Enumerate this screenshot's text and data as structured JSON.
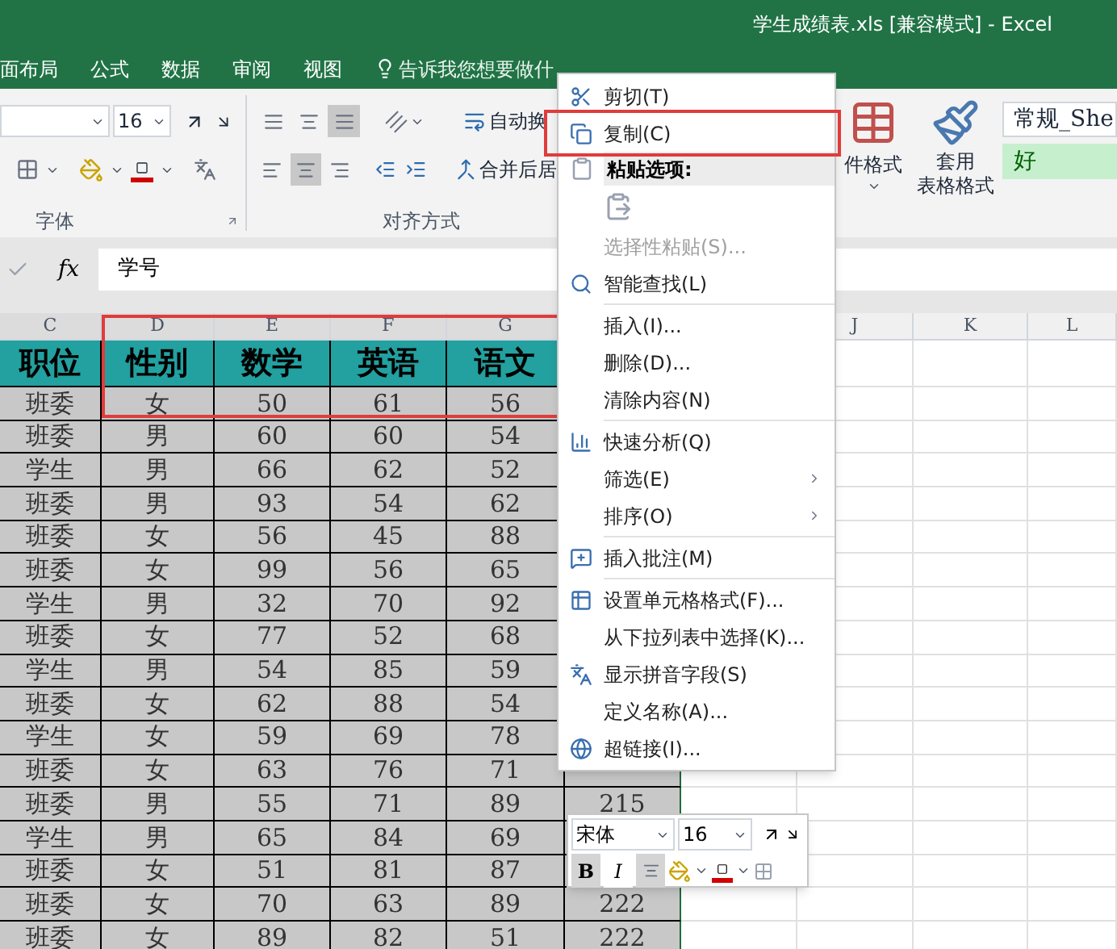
{
  "window": {
    "title": "学生成绩表.xls  [兼容模式] - Excel"
  },
  "tabs": [
    {
      "label": "面布局",
      "selected": false
    },
    {
      "label": "公式",
      "selected": false
    },
    {
      "label": "数据",
      "selected": false
    },
    {
      "label": "审阅",
      "selected": false
    },
    {
      "label": "视图",
      "selected": false
    }
  ],
  "tell_me": {
    "placeholder": "告诉我您想要做什"
  },
  "ribbon": {
    "font_size": "16",
    "font_group_label": "字体",
    "align_group_label": "对齐方式",
    "wrap_text": "自动换",
    "merge": "合并后居",
    "vertical_align": [
      {
        "pressed": false
      },
      {
        "pressed": false
      },
      {
        "pressed": true
      }
    ],
    "horizontal_align": [
      {
        "pressed": false
      },
      {
        "pressed": true
      },
      {
        "pressed": false
      }
    ],
    "conditional_format": "件格式",
    "table_format": [
      "套用",
      "表格格式"
    ],
    "styles": [
      {
        "label": "常规_She",
        "kind": "normal"
      },
      {
        "label": "好",
        "kind": "good"
      }
    ]
  },
  "formula_bar": {
    "function_label": "fx",
    "value": "学号"
  },
  "sheet": {
    "columns": [
      "C",
      "D",
      "E",
      "F",
      "G",
      null,
      null,
      "J",
      "K",
      "L"
    ],
    "header_row": [
      "职位",
      "性别",
      "数学",
      "英语",
      "语文"
    ],
    "rows": [
      {
        "cells": [
          "班委",
          "女",
          "50",
          "61",
          "56"
        ]
      },
      {
        "cells": [
          "班委",
          "男",
          "60",
          "60",
          "54"
        ]
      },
      {
        "cells": [
          "学生",
          "男",
          "66",
          "62",
          "52"
        ]
      },
      {
        "cells": [
          "班委",
          "男",
          "93",
          "54",
          "62"
        ]
      },
      {
        "cells": [
          "班委",
          "女",
          "56",
          "45",
          "88"
        ]
      },
      {
        "cells": [
          "班委",
          "女",
          "99",
          "56",
          "65"
        ]
      },
      {
        "cells": [
          "学生",
          "男",
          "32",
          "70",
          "92"
        ]
      },
      {
        "cells": [
          "班委",
          "女",
          "77",
          "52",
          "68"
        ]
      },
      {
        "cells": [
          "学生",
          "男",
          "54",
          "85",
          "59"
        ]
      },
      {
        "cells": [
          "班委",
          "女",
          "62",
          "88",
          "54"
        ]
      },
      {
        "cells": [
          "学生",
          "女",
          "59",
          "69",
          "78"
        ]
      },
      {
        "cells": [
          "班委",
          "女",
          "63",
          "76",
          "71"
        ]
      },
      {
        "cells": [
          "班委",
          "男",
          "55",
          "71",
          "89"
        ],
        "column_h": "215"
      },
      {
        "cells": [
          "学生",
          "男",
          "65",
          "84",
          "69"
        ]
      },
      {
        "cells": [
          "班委",
          "女",
          "51",
          "81",
          "87"
        ]
      },
      {
        "cells": [
          "班委",
          "女",
          "70",
          "63",
          "89"
        ],
        "column_h": "222"
      },
      {
        "cells": [
          "班委",
          "女",
          "89",
          "82",
          "51"
        ],
        "column_h": "222"
      }
    ]
  },
  "context_menu": [
    {
      "kind": "item",
      "label": "剪切(T)",
      "disabled": false,
      "submenu": false
    },
    {
      "kind": "item",
      "label": "复制(C)",
      "disabled": false,
      "submenu": false
    },
    {
      "kind": "header",
      "label": "粘贴选项:"
    },
    {
      "kind": "paste"
    },
    {
      "kind": "item",
      "label": "选择性粘贴(S)...",
      "disabled": true,
      "submenu": false
    },
    {
      "kind": "item",
      "label": "智能查找(L)",
      "disabled": false,
      "submenu": false
    },
    {
      "kind": "separator"
    },
    {
      "kind": "item",
      "label": "插入(I)...",
      "disabled": false,
      "submenu": false
    },
    {
      "kind": "item",
      "label": "删除(D)...",
      "disabled": false,
      "submenu": false
    },
    {
      "kind": "item",
      "label": "清除内容(N)",
      "disabled": false,
      "submenu": false
    },
    {
      "kind": "separator"
    },
    {
      "kind": "item",
      "label": "快速分析(Q)",
      "disabled": false,
      "submenu": false
    },
    {
      "kind": "item",
      "label": "筛选(E)",
      "disabled": false,
      "submenu": true
    },
    {
      "kind": "item",
      "label": "排序(O)",
      "disabled": false,
      "submenu": true
    },
    {
      "kind": "separator"
    },
    {
      "kind": "item",
      "label": "插入批注(M)",
      "disabled": false,
      "submenu": false
    },
    {
      "kind": "separator"
    },
    {
      "kind": "item",
      "label": "设置单元格格式(F)...",
      "disabled": false,
      "submenu": false
    },
    {
      "kind": "item",
      "label": "从下拉列表中选择(K)...",
      "disabled": false,
      "submenu": false
    },
    {
      "kind": "item",
      "label": "显示拼音字段(S)",
      "disabled": false,
      "submenu": false
    },
    {
      "kind": "item",
      "label": "定义名称(A)...",
      "disabled": false,
      "submenu": false
    },
    {
      "kind": "item",
      "label": "超链接(I)...",
      "disabled": false,
      "submenu": false
    }
  ],
  "mini_toolbar": {
    "font": "宋体",
    "size": "16",
    "buttons": [
      {
        "label": "B",
        "pressed": true
      },
      {
        "label": "I",
        "pressed": false
      }
    ],
    "align_pressed": true
  }
}
